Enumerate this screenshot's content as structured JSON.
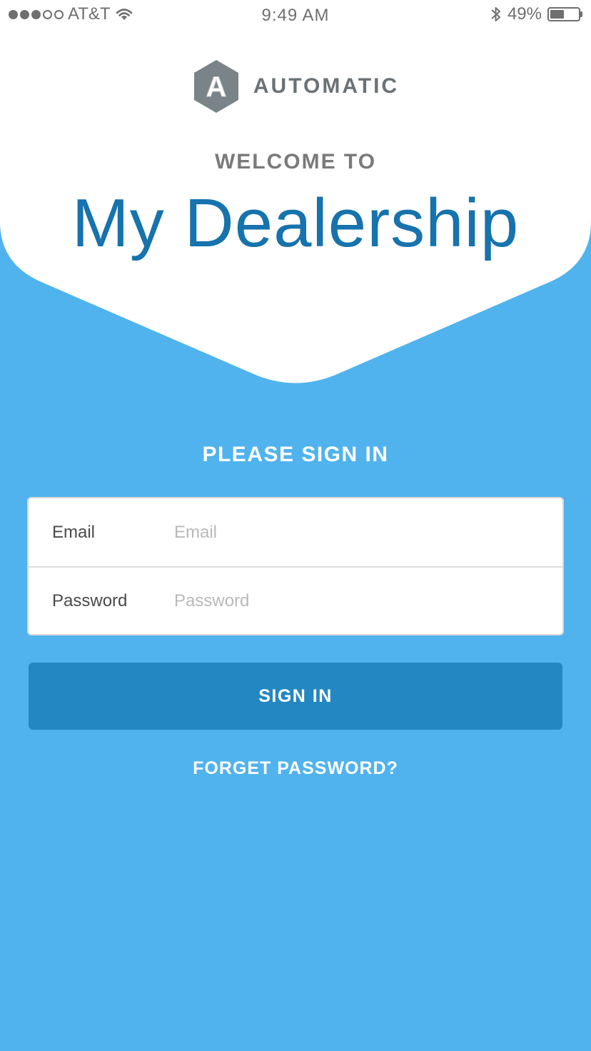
{
  "status_bar": {
    "carrier": "AT&T",
    "time": "9:49 AM",
    "battery_percent": "49%",
    "battery_level": 0.49,
    "signal_bars": 3,
    "signal_max": 5,
    "icons": [
      "signal-dots-icon",
      "wifi-icon",
      "bluetooth-icon",
      "battery-icon"
    ]
  },
  "brand": {
    "name": "AUTOMATIC",
    "logo_icon": "automatic-logo-icon",
    "logo_letter": "A"
  },
  "hero": {
    "welcome": "WELCOME TO",
    "title": "My Dealership"
  },
  "signin": {
    "heading": "PLEASE SIGN IN",
    "email_label": "Email",
    "email_placeholder": "Email",
    "email_value": "",
    "password_label": "Password",
    "password_placeholder": "Password",
    "password_value": "",
    "button_label": "SIGN IN",
    "forgot_label": "FORGET PASSWORD?"
  },
  "colors": {
    "background": "#50b3ed",
    "hero": "#ffffff",
    "title": "#1673ad",
    "button": "#2387c1",
    "logo": "#7a8387"
  }
}
